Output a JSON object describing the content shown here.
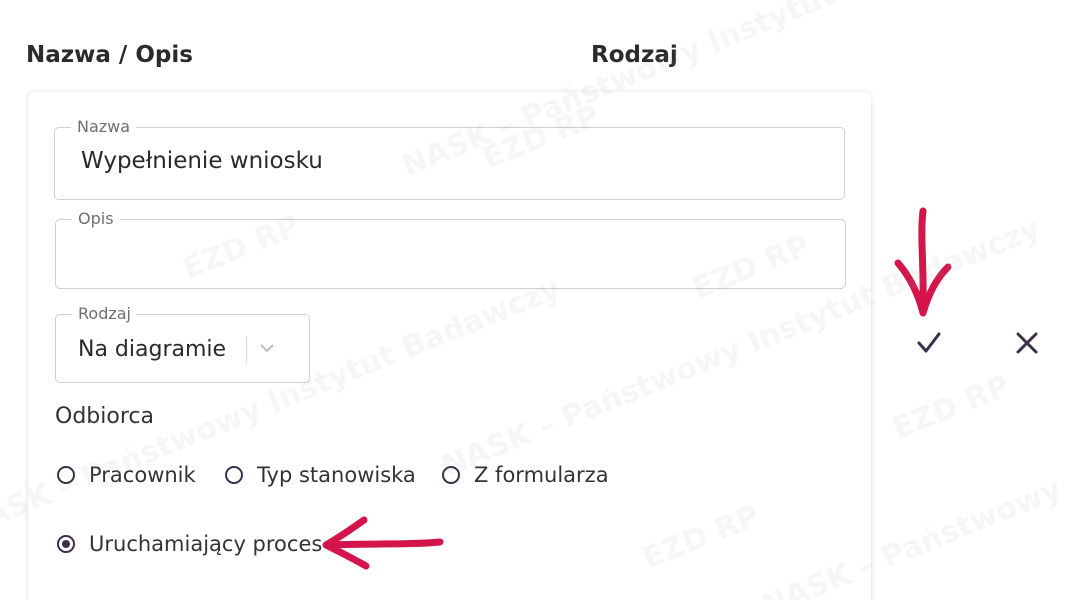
{
  "headers": {
    "name_col": "Nazwa / Opis",
    "type_col": "Rodzaj"
  },
  "form": {
    "nazwa": {
      "label": "Nazwa",
      "value": "Wypełnienie wniosku"
    },
    "opis": {
      "label": "Opis",
      "value": ""
    },
    "rodzaj": {
      "label": "Rodzaj",
      "value": "Na diagramie"
    },
    "odbiorca": {
      "label": "Odbiorca",
      "options": [
        {
          "label": "Pracownik",
          "checked": false
        },
        {
          "label": "Typ stanowiska",
          "checked": false
        },
        {
          "label": "Z formularza",
          "checked": false
        },
        {
          "label": "Uruchamiający proces",
          "checked": true
        }
      ]
    }
  },
  "actions": {
    "confirm_icon": "checkmark-icon",
    "cancel_icon": "close-icon"
  },
  "watermark": {
    "texts": [
      "NASK – Państwowy Instytut Badawczy",
      "EZD RP",
      "NASK"
    ]
  },
  "colors": {
    "icon": "#3b2f4a",
    "annotation_arrow": "#d4154c",
    "field_border": "#cfcfcf",
    "legend": "#6f6f6f"
  }
}
